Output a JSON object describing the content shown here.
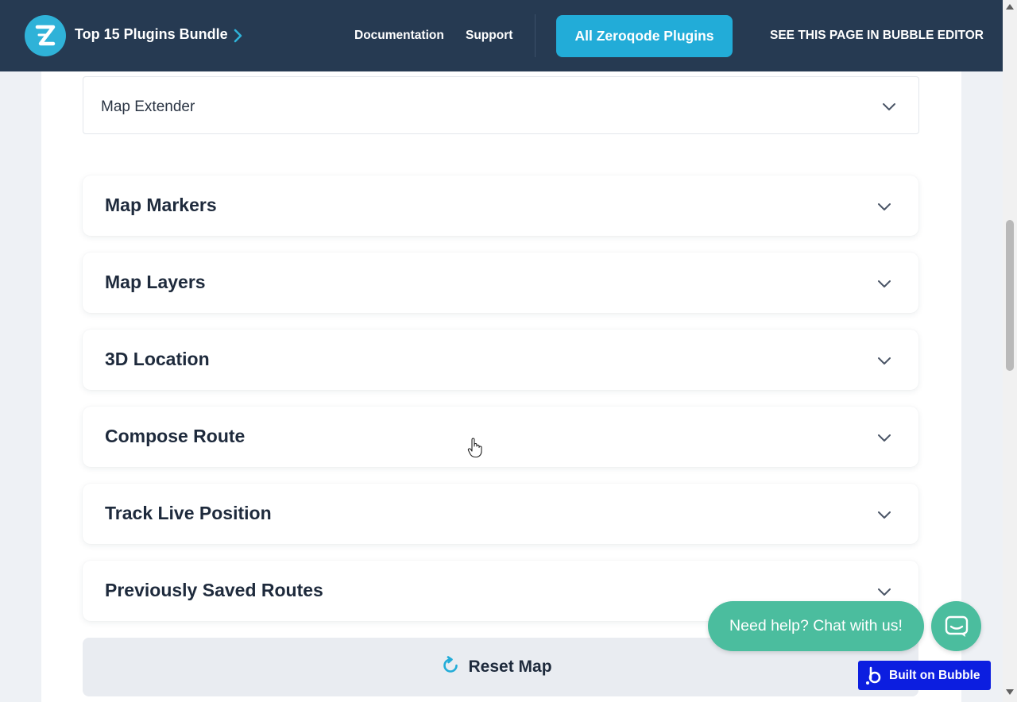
{
  "header": {
    "brand_title": "Top 15 Plugins Bundle",
    "nav": {
      "documentation": "Documentation",
      "support": "Support"
    },
    "all_plugins_button": "All Zeroqode Plugins",
    "editor_link": "SEE THIS PAGE IN BUBBLE EDITOR"
  },
  "plugin_select": {
    "selected": "Map Extender"
  },
  "accordions": [
    {
      "title": "Map Markers"
    },
    {
      "title": "Map Layers"
    },
    {
      "title": "3D Location"
    },
    {
      "title": "Compose Route"
    },
    {
      "title": "Track Live Position"
    },
    {
      "title": "Previously Saved Routes"
    }
  ],
  "reset_button": {
    "label": "Reset Map"
  },
  "chat": {
    "prompt": "Need help? Chat with us!"
  },
  "badge": {
    "label": "Built on Bubble"
  },
  "colors": {
    "header_bg": "#263a52",
    "accent": "#22acd8",
    "chat": "#4bbd9e",
    "bubble_badge": "#0c1ee0"
  }
}
